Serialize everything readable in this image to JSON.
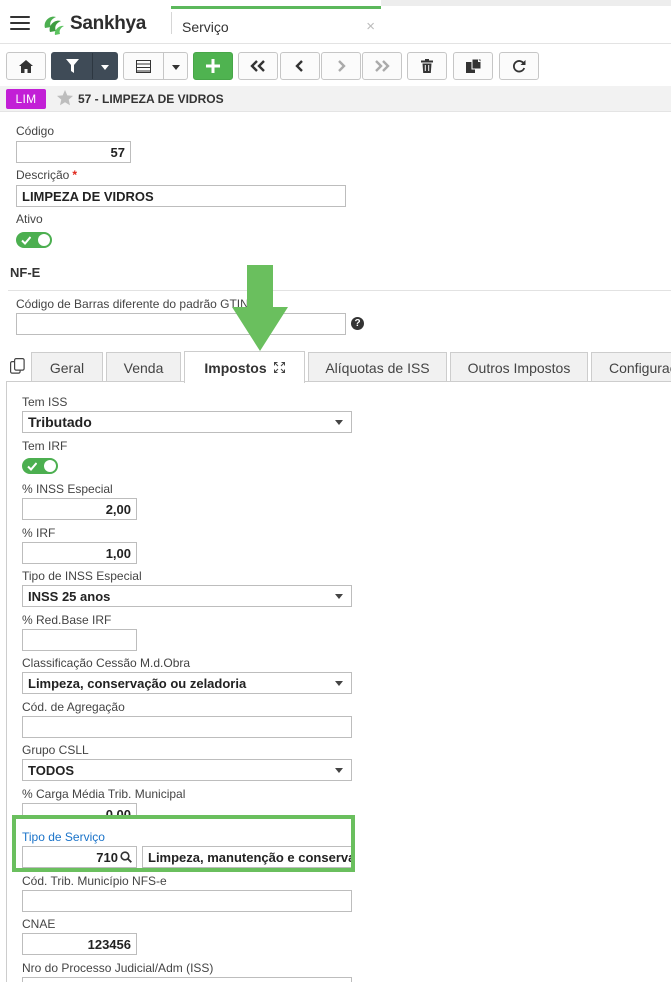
{
  "app": {
    "brand": "Sankhya",
    "tab_label": "Serviço",
    "tab_close": "×"
  },
  "toolbar": {
    "buttons": [
      {
        "icon": "home-icon"
      },
      {
        "icon": "filter-icon"
      },
      {
        "icon": "grid-view-icon"
      },
      {
        "icon": "add-icon"
      },
      {
        "icon": "first-record-icon"
      },
      {
        "icon": "previous-record-icon"
      },
      {
        "icon": "next-record-icon"
      },
      {
        "icon": "last-record-icon"
      },
      {
        "icon": "delete-icon"
      },
      {
        "icon": "duplicate-icon"
      },
      {
        "icon": "refresh-icon"
      }
    ]
  },
  "record": {
    "badge": "LIM",
    "badge_color": "#c21fd6",
    "title": "57 - LIMPEZA DE VIDROS"
  },
  "form": {
    "codigo_label": "Código",
    "codigo_value": "57",
    "descricao_label": "Descrição",
    "descricao_required": "*",
    "descricao_value": "LIMPEZA DE VIDROS",
    "ativo_label": "Ativo",
    "ativo_on": true
  },
  "nfe": {
    "section_title": "NF-E",
    "gtin_label": "Código de Barras diferente do padrão GTIN",
    "gtin_value": "",
    "help": "?"
  },
  "tabs": [
    {
      "label": "Geral",
      "active": false
    },
    {
      "label": "Venda",
      "active": false
    },
    {
      "label": "Impostos",
      "active": true
    },
    {
      "label": "Alíquotas de ISS",
      "active": false
    },
    {
      "label": "Outros Impostos",
      "active": false
    },
    {
      "label": "Configurac",
      "active": false
    }
  ],
  "impostos": {
    "tem_iss_label": "Tem ISS",
    "tem_iss_value": "Tributado",
    "tem_irf_label": "Tem IRF",
    "tem_irf_on": true,
    "inss_especial_label": "% INSS Especial",
    "inss_especial_value": "2,00",
    "irf_label": "% IRF",
    "irf_value": "1,00",
    "tipo_inss_label": "Tipo de INSS Especial",
    "tipo_inss_value": "INSS 25 anos",
    "red_base_irf_label": "% Red.Base IRF",
    "red_base_irf_value": "",
    "classif_label": "Classificação Cessão M.d.Obra",
    "classif_value": "Limpeza, conservação ou zeladoria",
    "cod_agregacao_label": "Cód. de Agregação",
    "cod_agregacao_value": "",
    "grupo_csll_label": "Grupo CSLL",
    "grupo_csll_value": "TODOS",
    "carga_media_label": "% Carga Média Trib. Municipal",
    "carga_media_value": "0,00",
    "tipo_servico_label": "Tipo de Serviço",
    "tipo_servico_code": "710",
    "tipo_servico_desc": "Limpeza, manutenção e conservação",
    "cod_trib_label": "Cód. Trib. Município NFS-e",
    "cod_trib_value": "",
    "cnae_label": "CNAE",
    "cnae_value": "123456",
    "nro_processo_label": "Nro do Processo Judicial/Adm (ISS)",
    "nro_processo_value": ""
  },
  "annotations": {
    "highlight_color": "#6abf5e"
  }
}
